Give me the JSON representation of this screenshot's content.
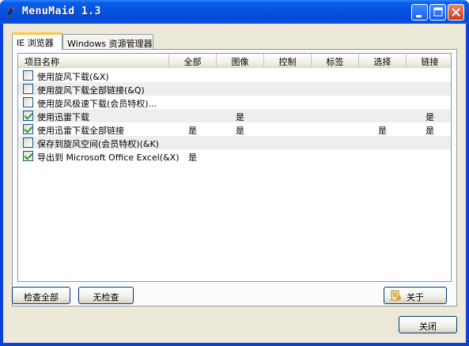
{
  "window": {
    "title": "MenuMaid 1.3",
    "icon": "menumaid-app-icon"
  },
  "tabs": [
    {
      "label": "IE 浏览器",
      "active": true
    },
    {
      "label": "Windows 资源管理器",
      "active": false
    }
  ],
  "list": {
    "columns": [
      "项目名称",
      "全部",
      "图像",
      "控制",
      "标签",
      "选择",
      "链接"
    ],
    "rows": [
      {
        "checked": false,
        "name": "使用旋风下载(&X)",
        "cells": [
          "",
          "",
          "",
          "",
          "",
          ""
        ]
      },
      {
        "checked": false,
        "name": "使用旋风下载全部链接(&Q)",
        "cells": [
          "",
          "",
          "",
          "",
          "",
          ""
        ]
      },
      {
        "checked": false,
        "name": "使用旋风极速下载(会员特权)...",
        "cells": [
          "",
          "",
          "",
          "",
          "",
          ""
        ]
      },
      {
        "checked": true,
        "name": "使用迅雷下载",
        "cells": [
          "",
          "是",
          "",
          "",
          "",
          "是"
        ]
      },
      {
        "checked": true,
        "name": "使用迅雷下载全部链接",
        "cells": [
          "是",
          "是",
          "",
          "",
          "是",
          "是"
        ]
      },
      {
        "checked": false,
        "name": "保存到旋风空间(会员特权)(&K)",
        "cells": [
          "",
          "",
          "",
          "",
          "",
          ""
        ]
      },
      {
        "checked": true,
        "name": "导出到 Microsoft Office Excel(&X)",
        "cells": [
          "是",
          "",
          "",
          "",
          "",
          ""
        ]
      }
    ]
  },
  "buttons": {
    "check_all": "检查全部",
    "uncheck_all": "无检查",
    "about": "关于",
    "close": "关闭"
  },
  "colors": {
    "titlebar": "#0654e0",
    "client": "#ece9d8",
    "check_mark": "#21a121",
    "close_button": "#c9401d",
    "tab_highlight": "#ffc83c"
  }
}
